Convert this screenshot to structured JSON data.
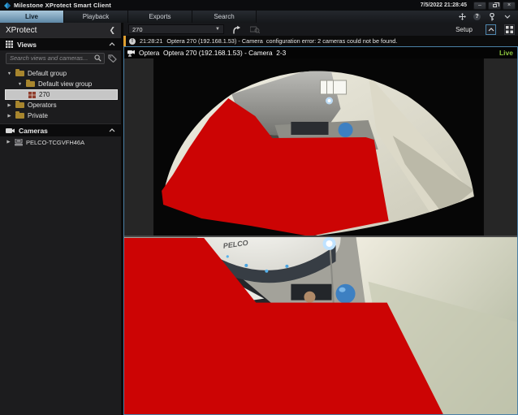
{
  "window": {
    "title": "Milestone XProtect Smart Client",
    "clock": "7/5/2022 21:28:45",
    "minimize_glyph": "–",
    "close_glyph": "×"
  },
  "tabs": [
    {
      "label": "Live",
      "active": true
    },
    {
      "label": "Playback",
      "active": false
    },
    {
      "label": "Exports",
      "active": false
    },
    {
      "label": "Search",
      "active": false
    }
  ],
  "tabbar_icons": {
    "help_glyph": "?"
  },
  "sidebar": {
    "title": "XProtect",
    "views_header": "Views",
    "cameras_header": "Cameras",
    "search_placeholder": "Search views and cameras...",
    "tree": [
      {
        "label": "Default group",
        "level": 0,
        "state": "expanded"
      },
      {
        "label": "Default view group",
        "level": 1,
        "state": "expanded"
      },
      {
        "label": "270",
        "level": 2,
        "state": "selected"
      },
      {
        "label": "Operators",
        "level": 0,
        "state": "collapsed"
      },
      {
        "label": "Private",
        "level": 0,
        "state": "collapsed"
      }
    ],
    "camera_tree": [
      {
        "label": "PELCO-TCGVFH46A",
        "state": "collapsed"
      }
    ]
  },
  "toolbar": {
    "view_selector_value": "270",
    "setup_label": "Setup"
  },
  "notification": {
    "time": "21:28:21",
    "message": "Optera 270 (192.168.1.53) - Camera  configuration error: 2 cameras could not be found."
  },
  "camera_view": {
    "title": "Optera  Optera 270 (192.168.1.53) - Camera  2-3",
    "live_label": "Live",
    "dome_label": "PELCO"
  },
  "colors": {
    "privacy_mask": "#cc0404",
    "tile_border_blue": "#4a80a6",
    "live_green": "#8dc63f",
    "warning_yellow": "#e0a030",
    "selected_row_gray": "#c6c6c6",
    "active_tab_blue": "#7fa8c4"
  },
  "tree_glyphs": {
    "expanded": "▼",
    "collapsed": "▶"
  }
}
